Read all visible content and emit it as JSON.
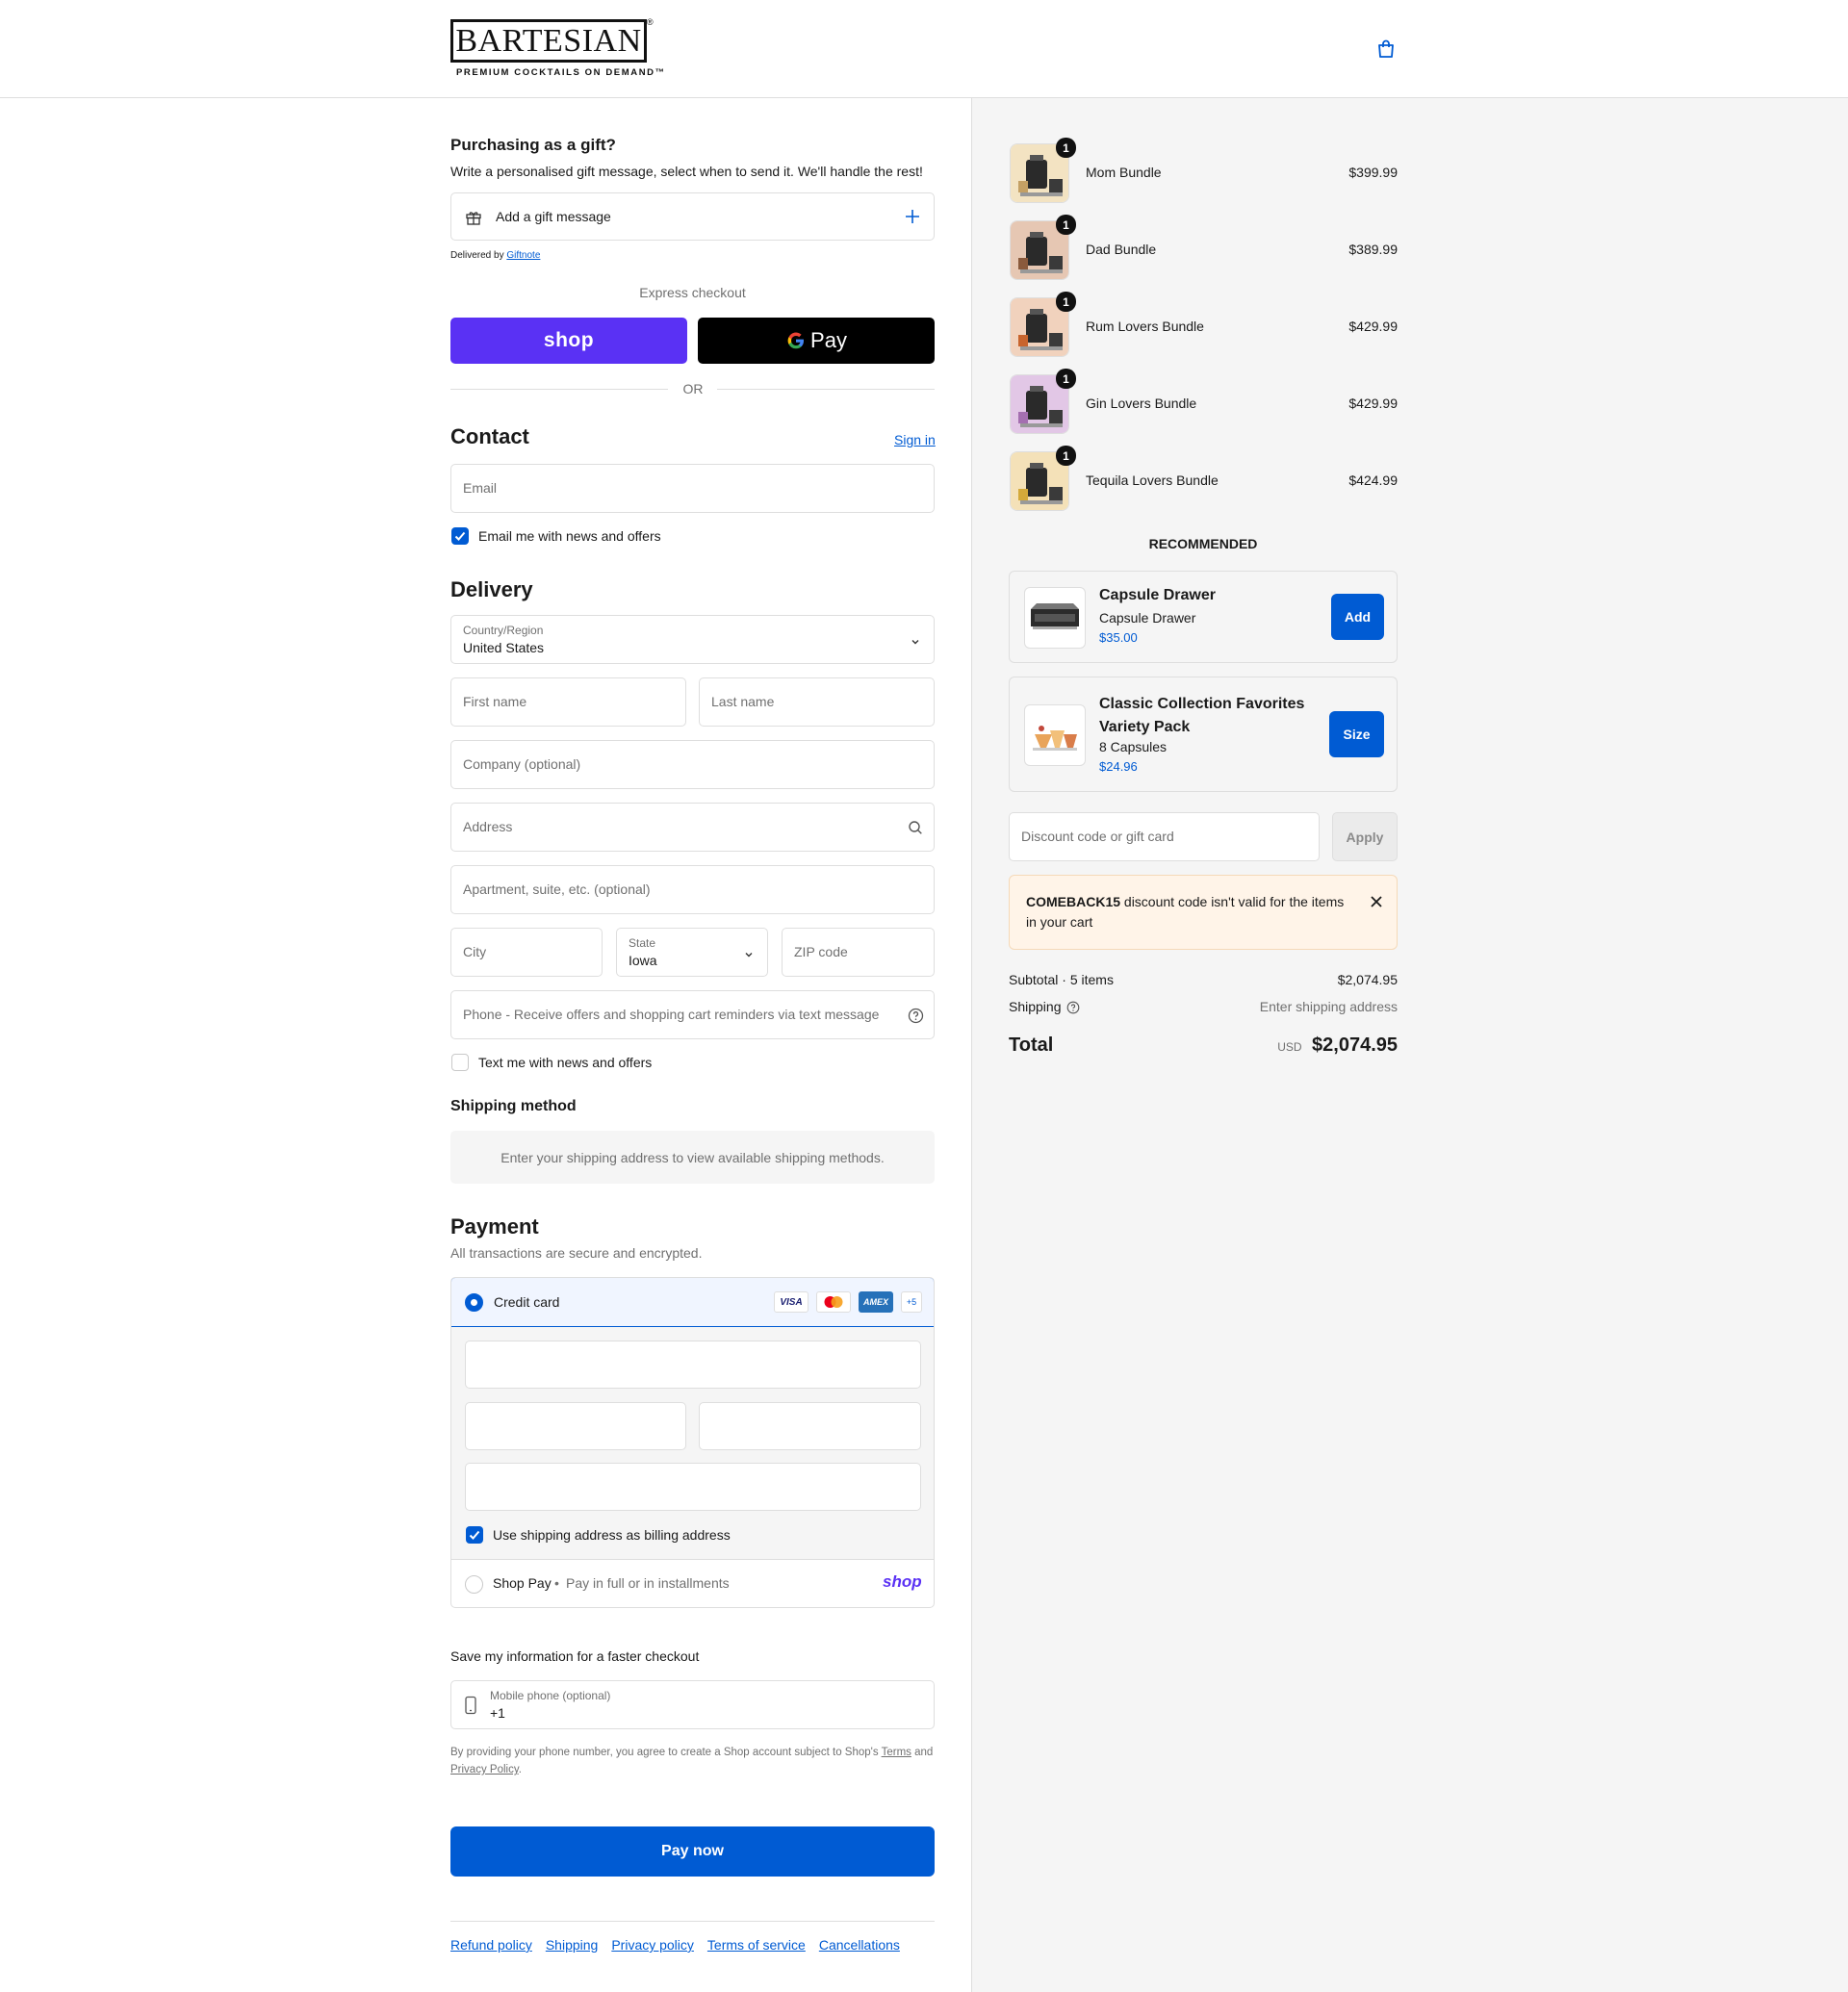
{
  "brand": {
    "name": "BARTESIAN",
    "reg": "®",
    "tagline": "PREMIUM COCKTAILS ON DEMAND™"
  },
  "gift": {
    "heading": "Purchasing as a gift?",
    "subtext": "Write a personalised gift message, select when to send it. We'll handle the rest!",
    "button_label": "Add a gift message",
    "delivered_by": "Delivered by",
    "delivered_link": "Giftnote"
  },
  "express": {
    "label": "Express checkout",
    "shop_label": "shop",
    "gpay_label": "Pay",
    "or_label": "OR"
  },
  "contact": {
    "heading": "Contact",
    "sign_in": "Sign in",
    "email_placeholder": "Email",
    "email_opt_in": "Email me with news and offers",
    "email_opt_in_checked": true
  },
  "delivery": {
    "heading": "Delivery",
    "country_label": "Country/Region",
    "country_value": "United States",
    "first_name_placeholder": "First name",
    "last_name_placeholder": "Last name",
    "company_placeholder": "Company (optional)",
    "address_placeholder": "Address",
    "apartment_placeholder": "Apartment, suite, etc. (optional)",
    "city_placeholder": "City",
    "state_label": "State",
    "state_value": "Iowa",
    "zip_placeholder": "ZIP code",
    "phone_placeholder": "Phone - Receive offers and shopping cart reminders via text message",
    "text_opt_in": "Text me with news and offers",
    "text_opt_in_checked": false
  },
  "shipping_method": {
    "heading": "Shipping method",
    "notice": "Enter your shipping address to view available shipping methods."
  },
  "payment": {
    "heading": "Payment",
    "subtext": "All transactions are secure and encrypted.",
    "credit_card_label": "Credit card",
    "card_brands": [
      "VISA",
      "mastercard",
      "AMEX",
      "+5"
    ],
    "billing_same_label": "Use shipping address as billing address",
    "billing_same_checked": true,
    "shop_pay_label": "Shop Pay",
    "shop_pay_sub": "Pay in full or in installments",
    "shop_pay_logo": "shop"
  },
  "save_info": {
    "heading": "Save my information for a faster checkout",
    "mobile_label": "Mobile phone (optional)",
    "mobile_value": "+1",
    "legal_prefix": "By providing your phone number, you agree to create a Shop account subject to Shop's",
    "terms_link": "Terms",
    "and_text": "and",
    "privacy_link": "Privacy Policy",
    "period": "."
  },
  "pay_now": "Pay now",
  "footer_links": [
    "Refund policy",
    "Shipping",
    "Privacy policy",
    "Terms of service",
    "Cancellations"
  ],
  "cart": {
    "items": [
      {
        "name": "Mom Bundle",
        "qty": "1",
        "price": "$399.99",
        "tint": "#f3e3c2"
      },
      {
        "name": "Dad Bundle",
        "qty": "1",
        "price": "$389.99",
        "tint": "#e6c7b3"
      },
      {
        "name": "Rum Lovers Bundle",
        "qty": "1",
        "price": "$429.99",
        "tint": "#f1d2bd"
      },
      {
        "name": "Gin Lovers Bundle",
        "qty": "1",
        "price": "$429.99",
        "tint": "#e2c7e6"
      },
      {
        "name": "Tequila Lovers Bundle",
        "qty": "1",
        "price": "$424.99",
        "tint": "#f4e1b8"
      }
    ],
    "recommended_heading": "RECOMMENDED",
    "recommended": [
      {
        "title": "Capsule Drawer",
        "sub": "Capsule Drawer",
        "price": "$35.00",
        "button": "Add"
      },
      {
        "title": "Classic Collection Favorites Variety Pack",
        "sub": "8 Capsules",
        "price": "$24.96",
        "button": "Size"
      }
    ],
    "discount_placeholder": "Discount code or gift card",
    "apply_label": "Apply",
    "discount_error_code": "COMEBACK15",
    "discount_error_text": "discount code isn't valid for the items in your cart",
    "subtotal_label": "Subtotal · 5 items",
    "subtotal_value": "$2,074.95",
    "shipping_label": "Shipping",
    "shipping_value": "Enter shipping address",
    "total_label": "Total",
    "total_currency": "USD",
    "total_value": "$2,074.95"
  },
  "colors": {
    "accent": "#005bd3",
    "shop_purple": "#5a31f4",
    "error_bg": "#fff4e8"
  }
}
